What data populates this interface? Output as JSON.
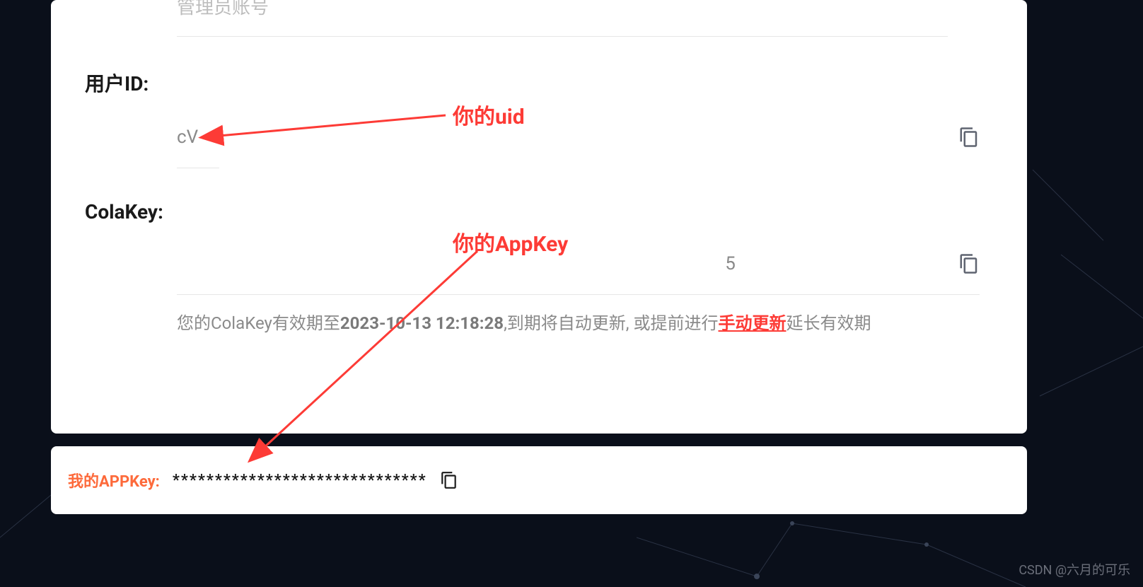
{
  "admin_placeholder": "管理员账号",
  "fields": {
    "uid": {
      "label": "用户ID:",
      "value": "cV"
    },
    "colakey": {
      "label": "ColaKey:",
      "value": "5"
    }
  },
  "expiry": {
    "prefix": "您的ColaKey有效期至",
    "date": "2023-10-13 12:18:28",
    "mid": ",到期将自动更新, 或提前进行",
    "link": "手动更新",
    "suffix": "延长有效期"
  },
  "appkey": {
    "label": "我的APPKey:",
    "value": "******************************"
  },
  "annotations": {
    "uid": "你的uid",
    "appkey": "你的AppKey"
  },
  "watermark": "CSDN @六月的可乐"
}
